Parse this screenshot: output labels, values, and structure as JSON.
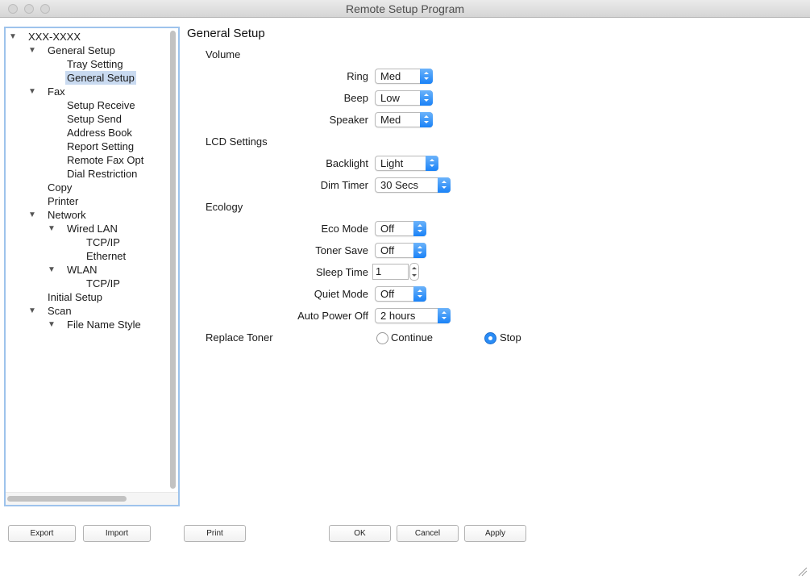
{
  "window": {
    "title": "Remote Setup Program"
  },
  "tree": [
    {
      "label": "XXX-XXXX",
      "level": 0,
      "expanded": true
    },
    {
      "label": "General Setup",
      "level": 1,
      "expanded": true
    },
    {
      "label": "Tray Setting",
      "level": 2
    },
    {
      "label": "General Setup",
      "level": 2,
      "selected": true
    },
    {
      "label": "Fax",
      "level": 1,
      "expanded": true
    },
    {
      "label": "Setup Receive",
      "level": 2
    },
    {
      "label": "Setup Send",
      "level": 2
    },
    {
      "label": "Address Book",
      "level": 2
    },
    {
      "label": "Report Setting",
      "level": 2
    },
    {
      "label": "Remote Fax Opt",
      "level": 2
    },
    {
      "label": "Dial Restriction",
      "level": 2
    },
    {
      "label": "Copy",
      "level": 1
    },
    {
      "label": "Printer",
      "level": 1
    },
    {
      "label": "Network",
      "level": 1,
      "expanded": true
    },
    {
      "label": "Wired LAN",
      "level": 2,
      "expanded": true
    },
    {
      "label": "TCP/IP",
      "level": 3
    },
    {
      "label": "Ethernet",
      "level": 3
    },
    {
      "label": "WLAN",
      "level": 2,
      "expanded": true
    },
    {
      "label": "TCP/IP",
      "level": 3
    },
    {
      "label": "Initial Setup",
      "level": 1
    },
    {
      "label": "Scan",
      "level": 1,
      "expanded": true
    },
    {
      "label": "File Name Style",
      "level": 2,
      "expanded": true
    }
  ],
  "form": {
    "title": "General Setup",
    "volume": {
      "label": "Volume",
      "ring_label": "Ring",
      "ring_value": "Med",
      "beep_label": "Beep",
      "beep_value": "Low",
      "speaker_label": "Speaker",
      "speaker_value": "Med"
    },
    "lcd": {
      "label": "LCD Settings",
      "backlight_label": "Backlight",
      "backlight_value": "Light",
      "dimtimer_label": "Dim Timer",
      "dimtimer_value": "30 Secs"
    },
    "ecology": {
      "label": "Ecology",
      "eco_label": "Eco Mode",
      "eco_value": "Off",
      "toner_label": "Toner Save",
      "toner_value": "Off",
      "sleep_label": "Sleep Time",
      "sleep_value": "1",
      "quiet_label": "Quiet Mode",
      "quiet_value": "Off",
      "autopower_label": "Auto Power Off",
      "autopower_value": "2 hours"
    },
    "replace_toner": {
      "label": "Replace Toner",
      "option_continue": "Continue",
      "option_stop": "Stop",
      "selected": "Stop"
    }
  },
  "buttons": {
    "export": "Export",
    "import": "Import",
    "print": "Print",
    "ok": "OK",
    "cancel": "Cancel",
    "apply": "Apply"
  },
  "colors": {
    "accent": "#1a82f7",
    "selection": "#c9daf0",
    "focus_ring": "#9ec3ec"
  }
}
